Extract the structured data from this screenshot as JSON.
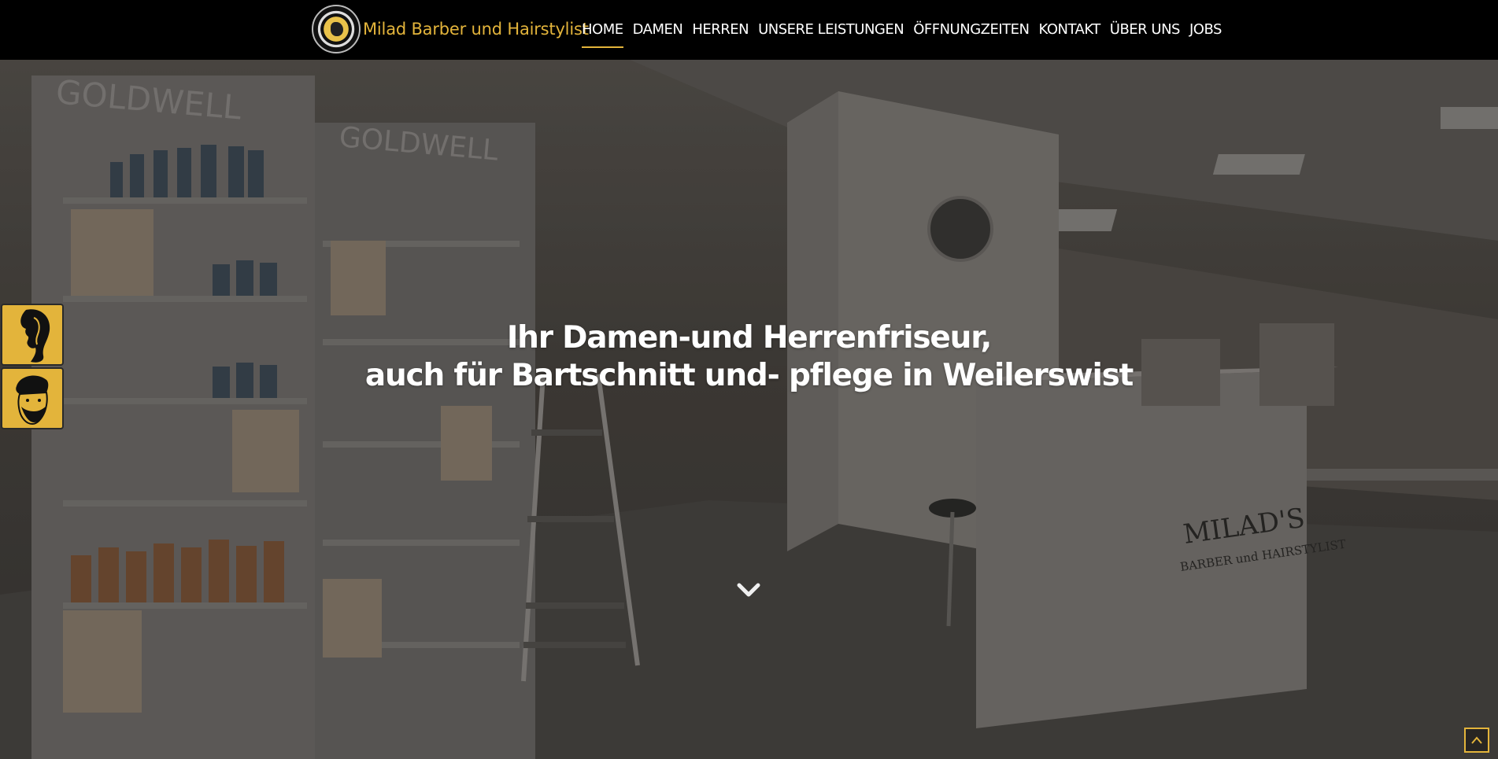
{
  "brand": {
    "name": "Milad Barber und Hairstylist",
    "logo_icon": "milad-logo-icon"
  },
  "nav": {
    "items": [
      {
        "label": "HOME",
        "active": true
      },
      {
        "label": "DAMEN",
        "active": false
      },
      {
        "label": "HERREN",
        "active": false
      },
      {
        "label": "UNSERE LEISTUNGEN",
        "active": false
      },
      {
        "label": "ÖFFNUNGZEITEN",
        "active": false
      },
      {
        "label": "KONTAKT",
        "active": false
      },
      {
        "label": "ÜBER UNS",
        "active": false
      },
      {
        "label": "JOBS",
        "active": false
      }
    ]
  },
  "hero": {
    "headline_line1": "Ihr Damen-und Herrenfriseur,",
    "headline_line2": "auch für Bartschnitt und- pflege in Weilerswist",
    "background_image": "salon-interior-photo",
    "scroll_icon": "chevron-down-icon"
  },
  "side_buttons": [
    {
      "name": "women-hair-button",
      "icon": "woman-silhouette-icon"
    },
    {
      "name": "men-hair-button",
      "icon": "man-beard-icon"
    }
  ],
  "back_to_top": {
    "icon": "chevron-up-icon"
  },
  "colors": {
    "accent": "#e3b43b",
    "navbar": "#000000",
    "text": "#ffffff"
  }
}
